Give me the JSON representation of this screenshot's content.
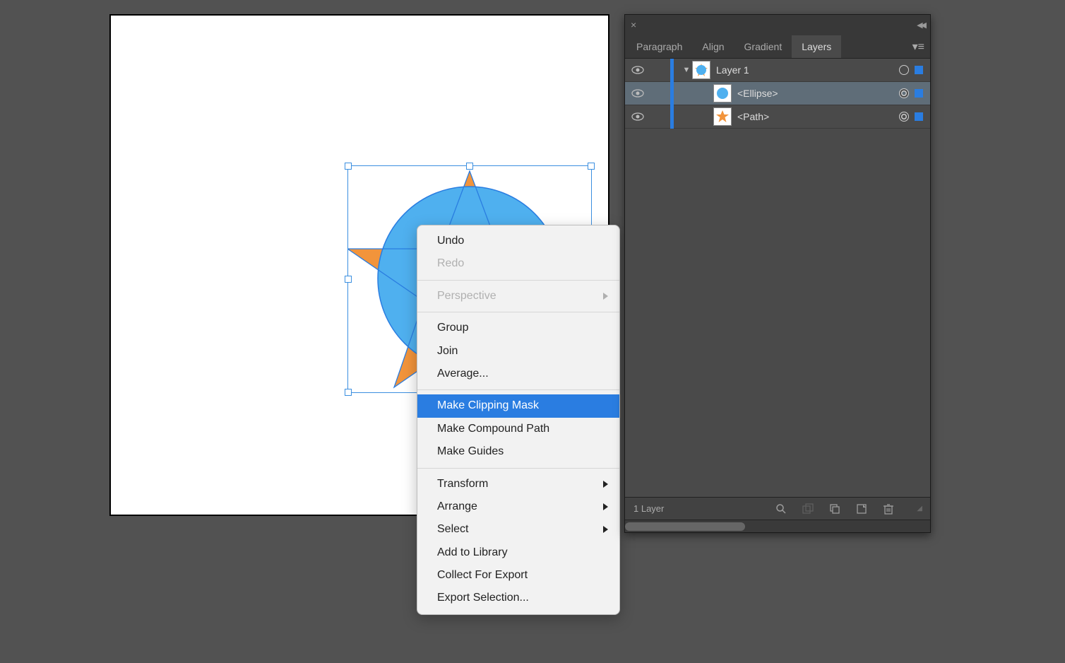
{
  "tabs": {
    "paragraph": "Paragraph",
    "align": "Align",
    "gradient": "Gradient",
    "layers": "Layers"
  },
  "layers": {
    "items": [
      {
        "name": "Layer 1",
        "expanded": true,
        "selected": true
      },
      {
        "name": "<Ellipse>",
        "selected": true
      },
      {
        "name": "<Path>",
        "selected": true
      }
    ],
    "count_label": "1 Layer"
  },
  "context_menu": {
    "undo": "Undo",
    "redo": "Redo",
    "perspective": "Perspective",
    "group": "Group",
    "join": "Join",
    "average": "Average...",
    "make_clipping_mask": "Make Clipping Mask",
    "make_compound_path": "Make Compound Path",
    "make_guides": "Make Guides",
    "transform": "Transform",
    "arrange": "Arrange",
    "select": "Select",
    "add_to_library": "Add to Library",
    "collect_for_export": "Collect For Export",
    "export_selection": "Export Selection..."
  },
  "colors": {
    "selection": "#2a7de1",
    "star": "#f2943b",
    "circle": "#4fb0ef"
  }
}
